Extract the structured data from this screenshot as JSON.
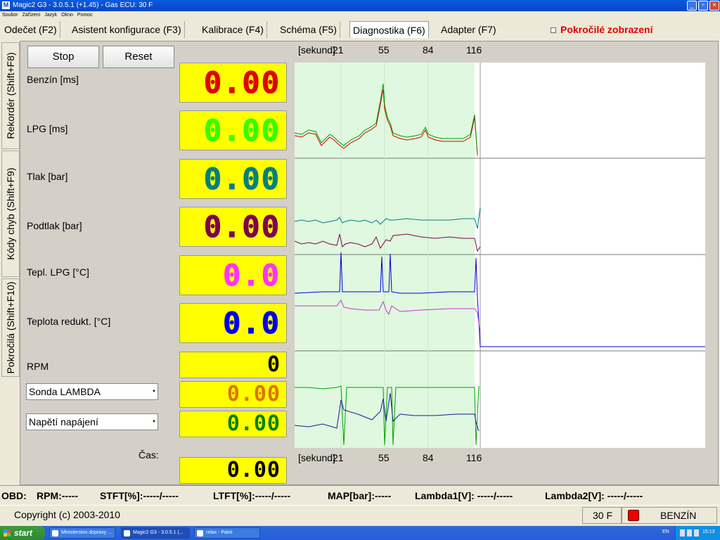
{
  "window": {
    "title": "Magic2 G3 - 3.0.5.1 (+1.45) - Gas ECU: 30 F",
    "icon": "M"
  },
  "menu": [
    "Soubor",
    "Zařízení",
    "Jazyk",
    "Okno",
    "Pomoc"
  ],
  "tabs": [
    {
      "label": "Odečet (F2)",
      "active": false
    },
    {
      "label": "Asistent konfigurace (F3)",
      "active": false
    },
    {
      "label": "Kalibrace (F4)",
      "active": false
    },
    {
      "label": "Schéma (F5)",
      "active": false
    },
    {
      "label": "Diagnostika (F6)",
      "active": true
    },
    {
      "label": "Adapter (F7)",
      "active": false
    }
  ],
  "advanced_checkbox": {
    "label": "Pokročilé zobrazení",
    "checked": false
  },
  "side_tabs": [
    "Rekordér (Shift+F8)",
    "Kódy chyb (Shift+F9)",
    "Pokročilá (Shift+F10)"
  ],
  "buttons": {
    "stop": "Stop",
    "reset": "Reset"
  },
  "channels": [
    {
      "label": "Benzín [ms]",
      "value": "0.00",
      "color": "#e00000"
    },
    {
      "label": "LPG [ms]",
      "value": "0.00",
      "color": "#33ff00"
    },
    {
      "label": "Tlak [bar]",
      "value": "0.00",
      "color": "#008080"
    },
    {
      "label": "Podtlak [bar]",
      "value": "0.00",
      "color": "#800050"
    },
    {
      "label": "Tepl. LPG [°C]",
      "value": "0.0",
      "color": "#ff33ff"
    },
    {
      "label": "Teplota redukt. [°C]",
      "value": "0.0",
      "color": "#0000ee"
    },
    {
      "label": "RPM",
      "value": "0",
      "color": "#000000"
    }
  ],
  "selects": [
    {
      "value": "Sonda LAMBDA",
      "display": "0.00",
      "color": "#e07000"
    },
    {
      "value": "Napětí napájení",
      "display": "0.00",
      "color": "#008000"
    }
  ],
  "time": {
    "label": "Čas:",
    "value": "0.00"
  },
  "time_axis": {
    "unit_label": "[sekund]",
    "ticks": [
      "21",
      "55",
      "84",
      "116"
    ]
  },
  "status": {
    "obd": "OBD:",
    "rpm": "RPM:-----",
    "stft": "STFT[%]:-----/-----",
    "ltft": "LTFT[%]:-----/-----",
    "map": "MAP[bar]:-----",
    "lambda1": "Lambda1[V]: -----/-----",
    "lambda2": "Lambda2[V]: -----/-----"
  },
  "footer": {
    "copyright": "Copyright (c) 2003-2010",
    "ecu": "30 F",
    "fuel": "BENZÍN",
    "fuel_indicator_color": "#ee0000"
  },
  "taskbar": {
    "start": "start",
    "tasks": [
      "Ministerstvo dopravy ...",
      "Magic2 G3 - 3.0.5.1 (...",
      "relax - Paint"
    ],
    "lang": "EN",
    "clock": "15:13"
  }
}
